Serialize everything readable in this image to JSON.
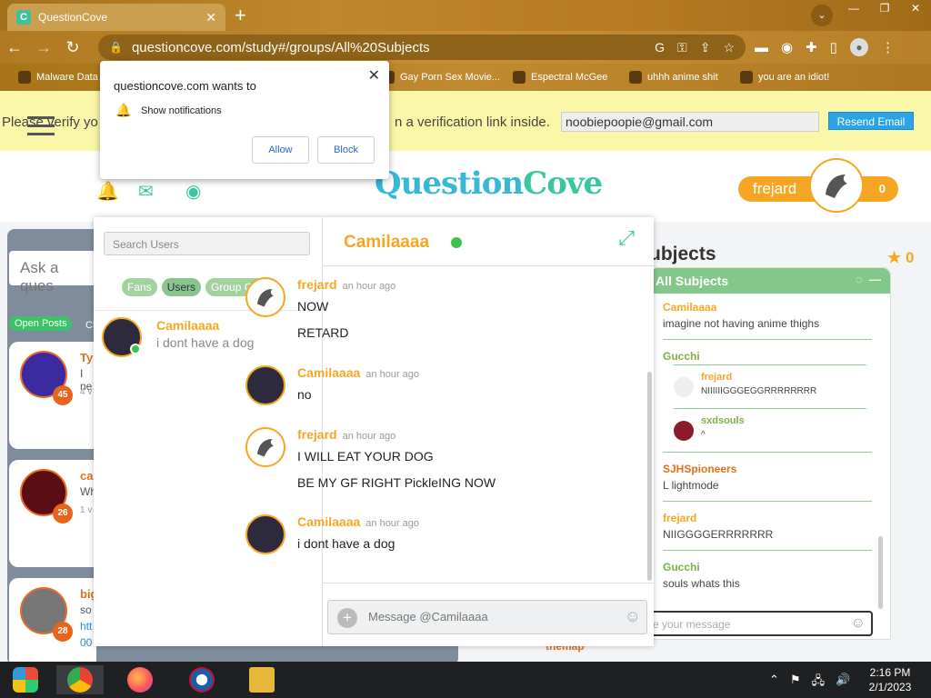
{
  "browser": {
    "tab_title": "QuestionCove",
    "tab_close": "✕",
    "new_tab": "+",
    "url": "questioncove.com/study#/groups/All%20Subjects",
    "window_buttons": [
      "—",
      "❐",
      "✕"
    ],
    "bookmarks": [
      {
        "label": "Malware Data"
      },
      {
        "label": "Gay Porn Sex Movie..."
      },
      {
        "label": "Espectral McGee"
      },
      {
        "label": "uhhh anime shit"
      },
      {
        "label": "you are an idiot!"
      }
    ]
  },
  "notification": {
    "title": "questioncove.com wants to",
    "permission": "Show notifications",
    "allow_label": "Allow",
    "block_label": "Block"
  },
  "verify_banner": {
    "text_left": "Please verify yo",
    "text_right": "n a verification link inside.",
    "email": "noobiepoopie@gmail.com",
    "resend_label": "Resend Email"
  },
  "header": {
    "logo_q": "Question",
    "logo_c": "Cove",
    "username": "frejard",
    "points": "0"
  },
  "feed": {
    "ask_placeholder": "Ask a ques",
    "open_posts_label": "Open Posts",
    "closed_label": "Cl",
    "posts": [
      {
        "name": "Ty",
        "text": "I ne",
        "sub": "4 v",
        "level": "45"
      },
      {
        "name": "ca",
        "text": "Wh",
        "sub": "1 v",
        "level": "26"
      },
      {
        "name": "big",
        "text": "so",
        "sub": "htt",
        "extra": "00",
        "level": "28"
      }
    ],
    "bottom_name": "themap"
  },
  "subjects": {
    "heading": "ubjects",
    "points": "0",
    "panel_title": "All Subjects",
    "messages": [
      {
        "name": "Camilaaaa",
        "text": "imagine not having anime thighs",
        "color": "#f6a623"
      },
      {
        "name": "Gucchi",
        "text": "",
        "color": "#7cb342"
      },
      {
        "name": "SJHSpioneers",
        "text": "L lightmode",
        "color": "#e0711c"
      },
      {
        "name": "frejard",
        "text": "NIIGGGGERRRRRRR",
        "color": "#f6a623"
      },
      {
        "name": "Gucchi",
        "text": "souls whats this",
        "color": "#7cb342"
      }
    ],
    "replies": [
      {
        "name": "frejard",
        "text": "NIIIIIIGGGEGGRRRRRRRR",
        "color": "#f6a623"
      },
      {
        "name": "sxdsouls",
        "text": "^",
        "color": "#7cb342"
      }
    ],
    "input_placeholder": "e your message"
  },
  "chat": {
    "search_placeholder": "Search Users",
    "filter_tabs": [
      "Fans",
      "Users",
      "Group Chats"
    ],
    "contact": {
      "name": "Camilaaaa",
      "last": "i dont have a dog"
    },
    "partner_name": "Camilaaaa",
    "messages": [
      {
        "author": "frejard",
        "time": "an hour ago",
        "lines": [
          "NOW",
          "RETARD"
        ]
      },
      {
        "author": "Camilaaaa",
        "time": "an hour ago",
        "lines": [
          "no"
        ]
      },
      {
        "author": "frejard",
        "time": "an hour ago",
        "lines": [
          "I WILL EAT YOUR DOG",
          "BE MY GF RIGHT PickleING NOW"
        ]
      },
      {
        "author": "Camilaaaa",
        "time": "an hour ago",
        "lines": [
          "i dont have a dog"
        ]
      }
    ],
    "compose_placeholder": "Message @Camilaaaa"
  },
  "taskbar": {
    "time": "2:16 PM",
    "date": "2/1/2023"
  }
}
